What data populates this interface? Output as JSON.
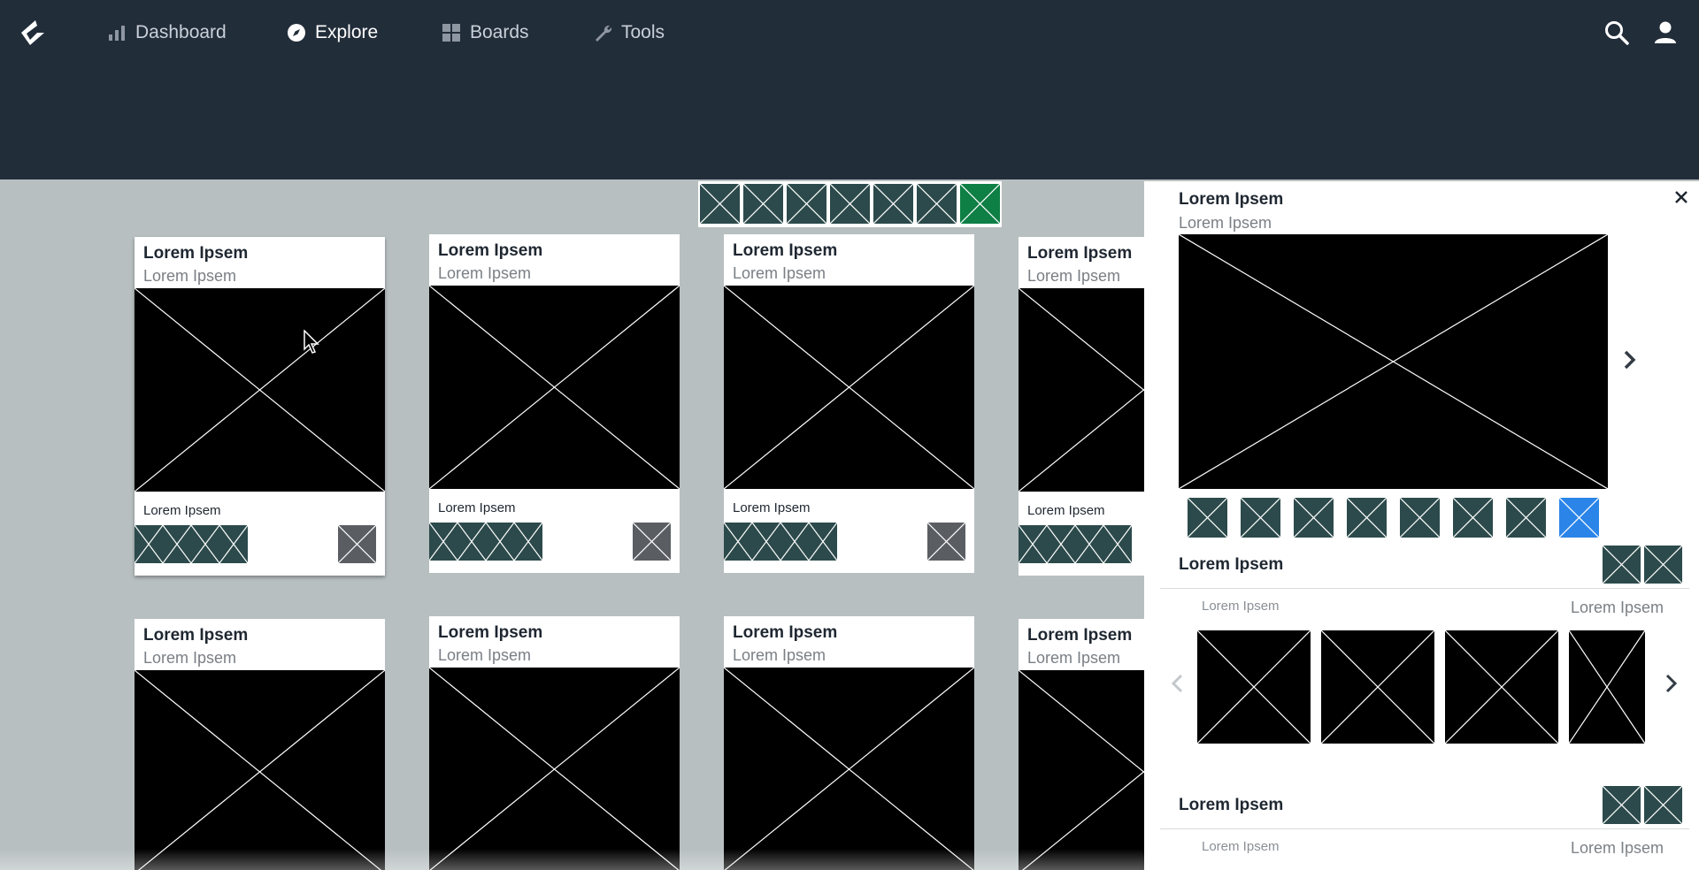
{
  "nav": {
    "items": [
      {
        "label": "Dashboard",
        "icon": "bar-chart-icon",
        "active": false
      },
      {
        "label": "Explore",
        "icon": "compass-icon",
        "active": true
      },
      {
        "label": "Boards",
        "icon": "grid-icon",
        "active": false
      },
      {
        "label": "Tools",
        "icon": "wrench-icon",
        "active": false
      }
    ]
  },
  "colors": {
    "topbar": "#222d3a",
    "background": "#b8bfc1",
    "tag": "#2c4a4b",
    "selected_green": "#0e7f45",
    "selected_blue": "#2b85e8"
  },
  "cards": [
    {
      "title": "Lorem Ipsem",
      "subtitle": "Lorem Ipsem",
      "footer_label": "Lorem Ipsem"
    },
    {
      "title": "Lorem Ipsem",
      "subtitle": "Lorem Ipsem",
      "footer_label": "Lorem Ipsem"
    },
    {
      "title": "Lorem Ipsem",
      "subtitle": "Lorem Ipsem",
      "footer_label": "Lorem Ipsem"
    },
    {
      "title": "Lorem Ipsem",
      "subtitle": "Lorem Ipsem",
      "footer_label": "Lorem Ipsem"
    },
    {
      "title": "Lorem Ipsem",
      "subtitle": "Lorem Ipsem"
    },
    {
      "title": "Lorem Ipsem",
      "subtitle": "Lorem Ipsem"
    },
    {
      "title": "Lorem Ipsem",
      "subtitle": "Lorem Ipsem"
    },
    {
      "title": "Lorem Ipsem",
      "subtitle": "Lorem Ipsem"
    }
  ],
  "panel": {
    "title": "Lorem Ipsem",
    "subtitle": "Lorem Ipsem",
    "sections": [
      {
        "title": "Lorem Ipsem",
        "left": "Lorem Ipsem",
        "right": "Lorem Ipsem"
      },
      {
        "title": "Lorem Ipsem",
        "left": "Lorem Ipsem",
        "right": "Lorem Ipsem"
      }
    ]
  }
}
